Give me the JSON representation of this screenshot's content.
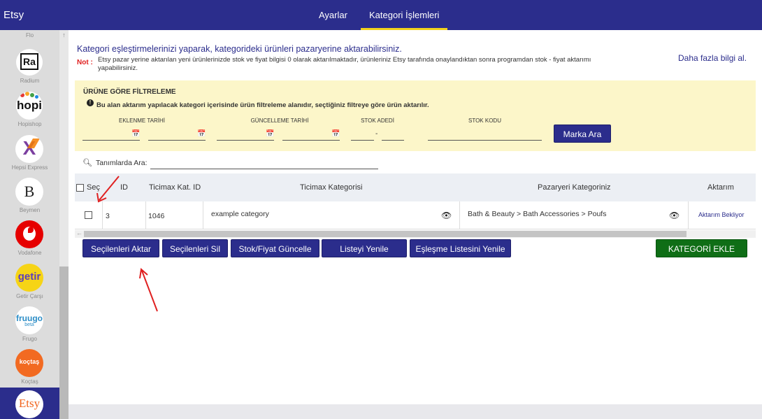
{
  "app": {
    "brand": "Etsy"
  },
  "topnav": {
    "tabs": [
      {
        "label": "Ayarlar"
      },
      {
        "label": "Kategori İşlemleri"
      }
    ]
  },
  "sidebar": {
    "clipped_label": "Flo",
    "items": [
      {
        "name": "Radium",
        "logo_text": "Ra",
        "icon": "radium-logo"
      },
      {
        "name": "Hopishop",
        "logo_text": "hopi",
        "icon": "hopi-logo"
      },
      {
        "name": "Hepsi Express",
        "logo_text": "X",
        "icon": "hepsi-express-logo"
      },
      {
        "name": "Beymen",
        "logo_text": "B",
        "icon": "beymen-logo"
      },
      {
        "name": "Vodafone",
        "logo_text": "",
        "icon": "vodafone-logo"
      },
      {
        "name": "Getir Çarşı",
        "logo_text": "getir",
        "icon": "getir-logo"
      },
      {
        "name": "Frugo",
        "logo_text": "fruugo",
        "logo_sub": "beta",
        "icon": "fruugo-logo"
      },
      {
        "name": "Koçtaş",
        "logo_text": "koçtaş",
        "icon": "koctas-logo"
      },
      {
        "name": "Etsy",
        "logo_text": "Etsy",
        "icon": "etsy-logo"
      }
    ]
  },
  "header": {
    "headline": "Kategori eşleştirmelerinizi yaparak, kategorideki ürünleri pazaryerine aktarabilirsiniz.",
    "note_label": "Not :",
    "note_text": "Etsy pazar yerine aktarılan yeni ürünlerinizde stok ve fiyat bilgisi 0 olarak aktarılmaktadır, ürünleriniz Etsy tarafında onaylandıktan sonra programdan stok - fiyat aktarımı yapabilirsiniz.",
    "more_info": "Daha fazla bilgi al."
  },
  "filter": {
    "title": "ÜRÜNE GÖRE FİLTRELEME",
    "info": "Bu alan aktarım yapılacak kategori içerisinde ürün filtreleme alanıdır, seçtiğiniz filtreye göre ürün aktarılır.",
    "created_label": "EKLENME TARİHİ",
    "updated_label": "GÜNCELLEME TARİHİ",
    "stock_qty_label": "STOK ADEDİ",
    "stock_code_label": "STOK KODU",
    "range_separator": "-",
    "search_button": "Marka Ara"
  },
  "search": {
    "label": "Tanımlarda Ara:",
    "value": ""
  },
  "table": {
    "headers": {
      "select": "Seç",
      "id": "ID",
      "ticimax_cat_id": "Ticimax Kat. ID",
      "ticimax_category": "Ticimax Kategorisi",
      "marketplace_category": "Pazaryeri Kategoriniz",
      "transfer": "Aktarım"
    },
    "rows": [
      {
        "id": "3",
        "ticimax_cat_id": "1046",
        "ticimax_category": "example category",
        "marketplace_category": "Bath & Beauty > Bath Accessories > Poufs",
        "status": "Aktarım Bekliyor"
      }
    ]
  },
  "actions": {
    "transfer_selected": "Seçilenleri Aktar",
    "delete_selected": "Seçilenleri Sil",
    "update_stock_price": "Stok/Fiyat Güncelle",
    "refresh_list": "Listeyi Yenile",
    "refresh_mapping_list": "Eşleşme Listesini Yenile",
    "add_category": "KATEGORİ EKLE"
  },
  "colors": {
    "primary": "#2b2d8c",
    "accent": "#f2d21c",
    "warning": "#e02020",
    "success": "#0f6e16",
    "filter_bg": "#fcf6c9",
    "annotation": "#e02020"
  }
}
